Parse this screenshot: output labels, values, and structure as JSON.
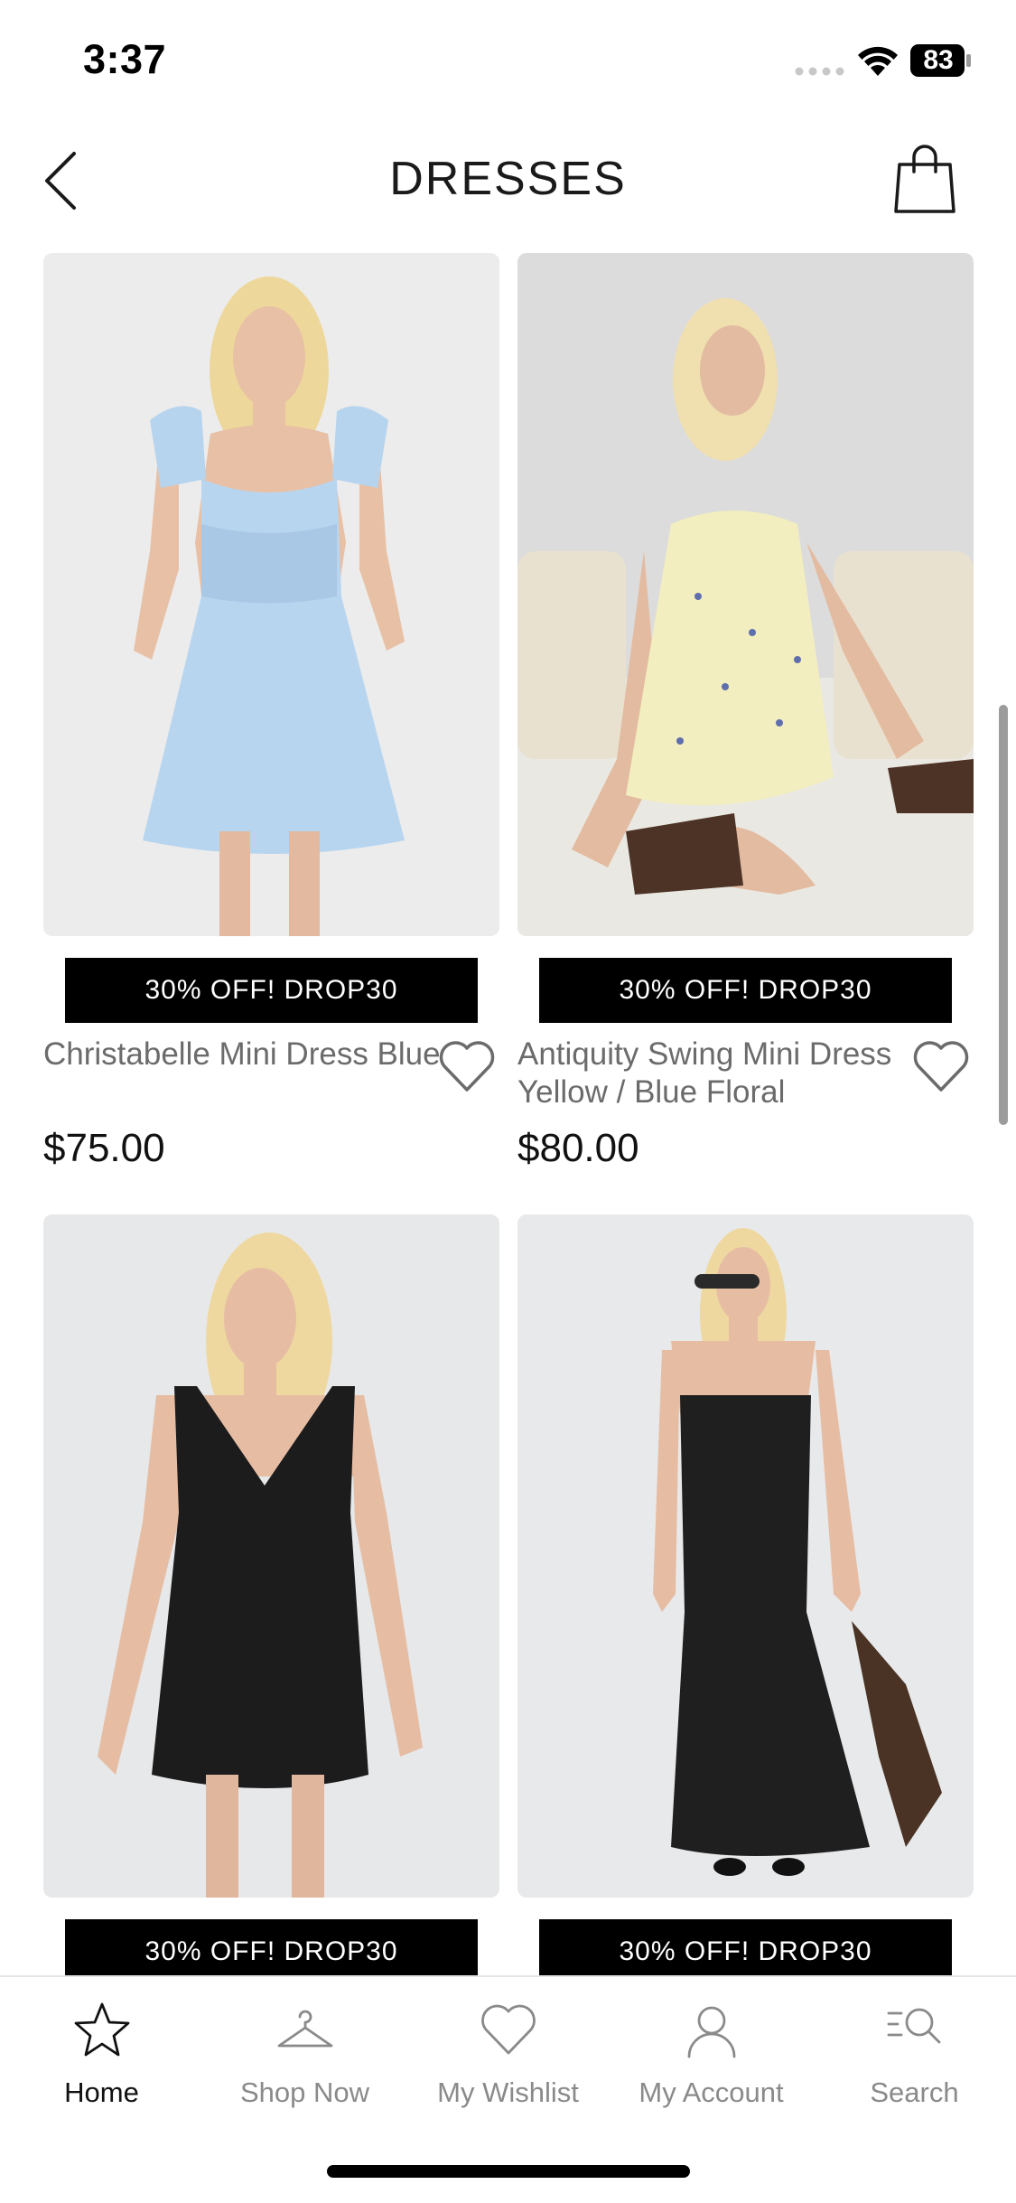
{
  "status_bar": {
    "time": "3:37",
    "battery": "83"
  },
  "header": {
    "title": "DRESSES"
  },
  "products": [
    {
      "name": "Christabelle Mini Dress Blue",
      "price": "$75.00",
      "promo": "30% OFF! DROP30",
      "image_icon": "dress-photo-light-blue-mini"
    },
    {
      "name": "Antiquity Swing Mini Dress Yellow / Blue Floral",
      "price": "$80.00",
      "promo": "30% OFF! DROP30",
      "image_icon": "dress-photo-yellow-floral-mini"
    },
    {
      "promo": "30% OFF! DROP30",
      "image_icon": "dress-photo-black-mini"
    },
    {
      "promo": "30% OFF! DROP30",
      "image_icon": "dress-photo-black-maxi"
    }
  ],
  "tabs": [
    {
      "label": "Home",
      "icon": "star-icon",
      "active": true
    },
    {
      "label": "Shop Now",
      "icon": "hanger-icon",
      "active": false
    },
    {
      "label": "My Wishlist",
      "icon": "heart-icon",
      "active": false
    },
    {
      "label": "My Account",
      "icon": "user-icon",
      "active": false
    },
    {
      "label": "Search",
      "icon": "search-icon",
      "active": false
    }
  ]
}
